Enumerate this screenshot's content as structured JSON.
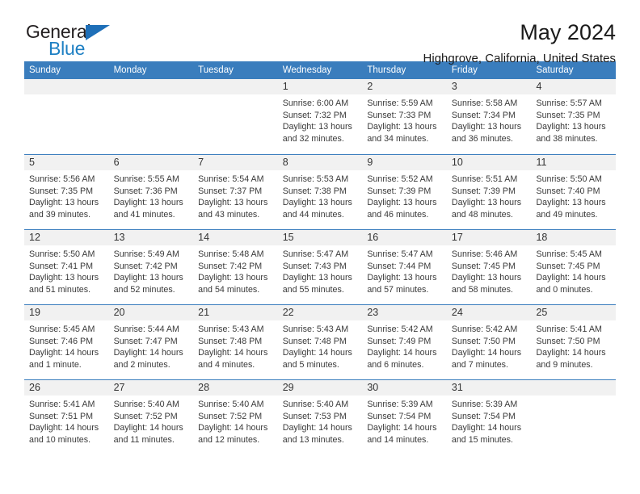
{
  "brand": {
    "name_dark": "General",
    "name_blue": "Blue",
    "triangle_color": "#1e6fb8",
    "blue_color": "#1d7fc3"
  },
  "header": {
    "title": "May 2024",
    "subtitle": "Highgrove, California, United States",
    "header_bg": "#3a7dbd",
    "band_bg": "#f1f1f1"
  },
  "weekdays": [
    "Sunday",
    "Monday",
    "Tuesday",
    "Wednesday",
    "Thursday",
    "Friday",
    "Saturday"
  ],
  "weeks": [
    [
      {
        "day": "",
        "sunrise": "",
        "sunset": "",
        "daylight1": "",
        "daylight2": "",
        "empty": true
      },
      {
        "day": "",
        "sunrise": "",
        "sunset": "",
        "daylight1": "",
        "daylight2": "",
        "empty": true
      },
      {
        "day": "",
        "sunrise": "",
        "sunset": "",
        "daylight1": "",
        "daylight2": "",
        "empty": true
      },
      {
        "day": "1",
        "sunrise": "Sunrise: 6:00 AM",
        "sunset": "Sunset: 7:32 PM",
        "daylight1": "Daylight: 13 hours",
        "daylight2": "and 32 minutes.",
        "empty": false
      },
      {
        "day": "2",
        "sunrise": "Sunrise: 5:59 AM",
        "sunset": "Sunset: 7:33 PM",
        "daylight1": "Daylight: 13 hours",
        "daylight2": "and 34 minutes.",
        "empty": false
      },
      {
        "day": "3",
        "sunrise": "Sunrise: 5:58 AM",
        "sunset": "Sunset: 7:34 PM",
        "daylight1": "Daylight: 13 hours",
        "daylight2": "and 36 minutes.",
        "empty": false
      },
      {
        "day": "4",
        "sunrise": "Sunrise: 5:57 AM",
        "sunset": "Sunset: 7:35 PM",
        "daylight1": "Daylight: 13 hours",
        "daylight2": "and 38 minutes.",
        "empty": false
      }
    ],
    [
      {
        "day": "5",
        "sunrise": "Sunrise: 5:56 AM",
        "sunset": "Sunset: 7:35 PM",
        "daylight1": "Daylight: 13 hours",
        "daylight2": "and 39 minutes.",
        "empty": false
      },
      {
        "day": "6",
        "sunrise": "Sunrise: 5:55 AM",
        "sunset": "Sunset: 7:36 PM",
        "daylight1": "Daylight: 13 hours",
        "daylight2": "and 41 minutes.",
        "empty": false
      },
      {
        "day": "7",
        "sunrise": "Sunrise: 5:54 AM",
        "sunset": "Sunset: 7:37 PM",
        "daylight1": "Daylight: 13 hours",
        "daylight2": "and 43 minutes.",
        "empty": false
      },
      {
        "day": "8",
        "sunrise": "Sunrise: 5:53 AM",
        "sunset": "Sunset: 7:38 PM",
        "daylight1": "Daylight: 13 hours",
        "daylight2": "and 44 minutes.",
        "empty": false
      },
      {
        "day": "9",
        "sunrise": "Sunrise: 5:52 AM",
        "sunset": "Sunset: 7:39 PM",
        "daylight1": "Daylight: 13 hours",
        "daylight2": "and 46 minutes.",
        "empty": false
      },
      {
        "day": "10",
        "sunrise": "Sunrise: 5:51 AM",
        "sunset": "Sunset: 7:39 PM",
        "daylight1": "Daylight: 13 hours",
        "daylight2": "and 48 minutes.",
        "empty": false
      },
      {
        "day": "11",
        "sunrise": "Sunrise: 5:50 AM",
        "sunset": "Sunset: 7:40 PM",
        "daylight1": "Daylight: 13 hours",
        "daylight2": "and 49 minutes.",
        "empty": false
      }
    ],
    [
      {
        "day": "12",
        "sunrise": "Sunrise: 5:50 AM",
        "sunset": "Sunset: 7:41 PM",
        "daylight1": "Daylight: 13 hours",
        "daylight2": "and 51 minutes.",
        "empty": false
      },
      {
        "day": "13",
        "sunrise": "Sunrise: 5:49 AM",
        "sunset": "Sunset: 7:42 PM",
        "daylight1": "Daylight: 13 hours",
        "daylight2": "and 52 minutes.",
        "empty": false
      },
      {
        "day": "14",
        "sunrise": "Sunrise: 5:48 AM",
        "sunset": "Sunset: 7:42 PM",
        "daylight1": "Daylight: 13 hours",
        "daylight2": "and 54 minutes.",
        "empty": false
      },
      {
        "day": "15",
        "sunrise": "Sunrise: 5:47 AM",
        "sunset": "Sunset: 7:43 PM",
        "daylight1": "Daylight: 13 hours",
        "daylight2": "and 55 minutes.",
        "empty": false
      },
      {
        "day": "16",
        "sunrise": "Sunrise: 5:47 AM",
        "sunset": "Sunset: 7:44 PM",
        "daylight1": "Daylight: 13 hours",
        "daylight2": "and 57 minutes.",
        "empty": false
      },
      {
        "day": "17",
        "sunrise": "Sunrise: 5:46 AM",
        "sunset": "Sunset: 7:45 PM",
        "daylight1": "Daylight: 13 hours",
        "daylight2": "and 58 minutes.",
        "empty": false
      },
      {
        "day": "18",
        "sunrise": "Sunrise: 5:45 AM",
        "sunset": "Sunset: 7:45 PM",
        "daylight1": "Daylight: 14 hours",
        "daylight2": "and 0 minutes.",
        "empty": false
      }
    ],
    [
      {
        "day": "19",
        "sunrise": "Sunrise: 5:45 AM",
        "sunset": "Sunset: 7:46 PM",
        "daylight1": "Daylight: 14 hours",
        "daylight2": "and 1 minute.",
        "empty": false
      },
      {
        "day": "20",
        "sunrise": "Sunrise: 5:44 AM",
        "sunset": "Sunset: 7:47 PM",
        "daylight1": "Daylight: 14 hours",
        "daylight2": "and 2 minutes.",
        "empty": false
      },
      {
        "day": "21",
        "sunrise": "Sunrise: 5:43 AM",
        "sunset": "Sunset: 7:48 PM",
        "daylight1": "Daylight: 14 hours",
        "daylight2": "and 4 minutes.",
        "empty": false
      },
      {
        "day": "22",
        "sunrise": "Sunrise: 5:43 AM",
        "sunset": "Sunset: 7:48 PM",
        "daylight1": "Daylight: 14 hours",
        "daylight2": "and 5 minutes.",
        "empty": false
      },
      {
        "day": "23",
        "sunrise": "Sunrise: 5:42 AM",
        "sunset": "Sunset: 7:49 PM",
        "daylight1": "Daylight: 14 hours",
        "daylight2": "and 6 minutes.",
        "empty": false
      },
      {
        "day": "24",
        "sunrise": "Sunrise: 5:42 AM",
        "sunset": "Sunset: 7:50 PM",
        "daylight1": "Daylight: 14 hours",
        "daylight2": "and 7 minutes.",
        "empty": false
      },
      {
        "day": "25",
        "sunrise": "Sunrise: 5:41 AM",
        "sunset": "Sunset: 7:50 PM",
        "daylight1": "Daylight: 14 hours",
        "daylight2": "and 9 minutes.",
        "empty": false
      }
    ],
    [
      {
        "day": "26",
        "sunrise": "Sunrise: 5:41 AM",
        "sunset": "Sunset: 7:51 PM",
        "daylight1": "Daylight: 14 hours",
        "daylight2": "and 10 minutes.",
        "empty": false
      },
      {
        "day": "27",
        "sunrise": "Sunrise: 5:40 AM",
        "sunset": "Sunset: 7:52 PM",
        "daylight1": "Daylight: 14 hours",
        "daylight2": "and 11 minutes.",
        "empty": false
      },
      {
        "day": "28",
        "sunrise": "Sunrise: 5:40 AM",
        "sunset": "Sunset: 7:52 PM",
        "daylight1": "Daylight: 14 hours",
        "daylight2": "and 12 minutes.",
        "empty": false
      },
      {
        "day": "29",
        "sunrise": "Sunrise: 5:40 AM",
        "sunset": "Sunset: 7:53 PM",
        "daylight1": "Daylight: 14 hours",
        "daylight2": "and 13 minutes.",
        "empty": false
      },
      {
        "day": "30",
        "sunrise": "Sunrise: 5:39 AM",
        "sunset": "Sunset: 7:54 PM",
        "daylight1": "Daylight: 14 hours",
        "daylight2": "and 14 minutes.",
        "empty": false
      },
      {
        "day": "31",
        "sunrise": "Sunrise: 5:39 AM",
        "sunset": "Sunset: 7:54 PM",
        "daylight1": "Daylight: 14 hours",
        "daylight2": "and 15 minutes.",
        "empty": false
      },
      {
        "day": "",
        "sunrise": "",
        "sunset": "",
        "daylight1": "",
        "daylight2": "",
        "empty": true
      }
    ]
  ]
}
